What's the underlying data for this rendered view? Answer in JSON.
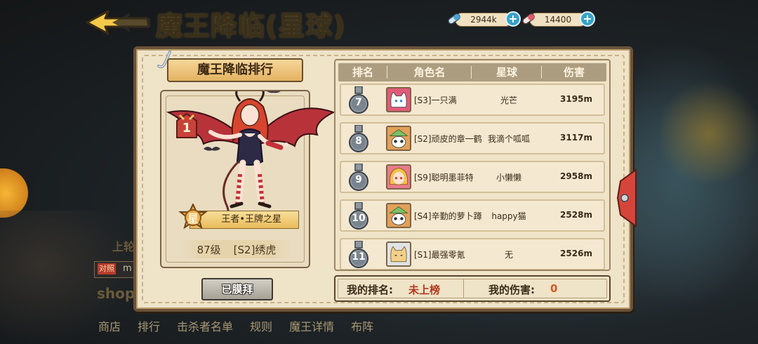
{
  "header": {
    "title": "魔王降临(星球)",
    "currencies": [
      {
        "value": "2944k",
        "icon": "capsule-blue-icon"
      },
      {
        "value": "14400",
        "icon": "capsule-red-icon"
      }
    ]
  },
  "background_menu": {
    "items": [
      "商店",
      "排行",
      "击杀者名单",
      "规则",
      "魔王详情",
      "布阵"
    ],
    "shop_label": "shop",
    "side_label": "上轮",
    "tag_label": "对照",
    "tag_text": "m"
  },
  "ranking": {
    "title": "魔王降临排行",
    "top_player": {
      "rank": "1",
      "title_badge": "星",
      "title_text": "王者•王牌之星",
      "level": "87级",
      "name": "[S2]绣虎"
    },
    "worship_button": "已膜拜",
    "columns": [
      "排名",
      "角色名",
      "星球",
      "伤害"
    ],
    "rows": [
      {
        "rank": "7",
        "name": "[S3]一只满",
        "planet": "光芒",
        "damage": "3195m",
        "avatar": "white-cat-avatar"
      },
      {
        "rank": "8",
        "name": "[S2]顽皮的章一鹤",
        "planet": "我滴个呱呱",
        "damage": "3117m",
        "avatar": "panda-leaf-hat-avatar"
      },
      {
        "rank": "9",
        "name": "[S9]聪明墨菲特",
        "planet": "小懒懒",
        "damage": "2958m",
        "avatar": "blonde-girl-avatar"
      },
      {
        "rank": "10",
        "name": "[S4]辛勤的萝卜蹲",
        "planet": "happy猫",
        "damage": "2528m",
        "avatar": "panda-leaf-hat-avatar"
      },
      {
        "rank": "11",
        "name": "[S1]最强零氪",
        "planet": "无",
        "damage": "2526m",
        "avatar": "blank-cat-avatar"
      }
    ],
    "my_rank_label": "我的排名:",
    "my_rank_value": "未上榜",
    "my_damage_label": "我的伤害:",
    "my_damage_value": "0"
  },
  "colors": {
    "panel": "#efe3c8",
    "border": "#6a5238",
    "accent_red": "#b03a1e",
    "header_bg": "#ad9d80"
  }
}
